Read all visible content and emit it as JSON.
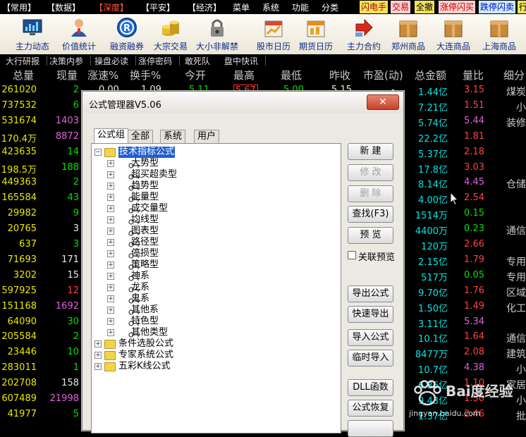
{
  "menubar": {
    "items": [
      "【常用】",
      "【数据】",
      "【深度】",
      "【平安】",
      "【经济】",
      "菜单",
      "系统",
      "功能",
      "分类"
    ],
    "active_index": 2,
    "quick_tabs": [
      {
        "label": "闪电手",
        "bg": "#f2e25a",
        "fg": "#b00000"
      },
      {
        "label": "交易",
        "bg": "#ffd0d0",
        "fg": "#c00000"
      },
      {
        "label": "全撤",
        "bg": "#f2e25a",
        "fg": "#000000"
      },
      {
        "label": "涨停闪买",
        "bg": "#ffd0d0",
        "fg": "#c00000"
      },
      {
        "label": "跌停闪卖",
        "bg": "#c8ecff",
        "fg": "#0000c0"
      },
      {
        "label": "行",
        "bg": "#f2e25a",
        "fg": "#000000"
      }
    ]
  },
  "toolbar": {
    "items": [
      {
        "label": "主力动态",
        "icon": "monitor-chart-icon"
      },
      {
        "label": "价值统计",
        "icon": "person-icon"
      },
      {
        "label": "融资融券",
        "icon": "registered-r-icon"
      },
      {
        "label": "大宗交易",
        "icon": "coin-stack-icon"
      },
      {
        "label": "大小非解禁",
        "icon": "padlock-icon"
      },
      {
        "label": "股市日历",
        "icon": "stock-calendar-icon"
      },
      {
        "label": "期货日历",
        "icon": "futures-calendar-icon"
      },
      {
        "label": "主力合约",
        "icon": "red-arrow-icon"
      },
      {
        "label": "郑州商品",
        "icon": "zhengzhou-box-icon"
      },
      {
        "label": "大连商品",
        "icon": "dalian-box-icon"
      },
      {
        "label": "上海商品",
        "icon": "shanghai-box-icon"
      }
    ]
  },
  "subtabs": [
    "大行研报",
    "决策内参",
    "操盘必读",
    "涨停密码",
    "敢死队",
    "盘中快讯"
  ],
  "table": {
    "headers": [
      "总量",
      "现量",
      "涨速%",
      "换手%",
      "今开",
      "最高",
      "最低",
      "昨收",
      "市盈(动)",
      "总金额",
      "量比",
      "细分"
    ],
    "top_row_partial": [
      "0.00",
      "1.09",
      "5.11",
      "5.67",
      "5.00",
      "5.15",
      "-"
    ],
    "rows": [
      {
        "vol": "261020",
        "now": "2",
        "now_color": "#00e000",
        "amt": "1.44亿",
        "ratio": "3.15",
        "ratio_color": "#ff4040",
        "ind": "煤炭"
      },
      {
        "vol": "737532",
        "now": "6",
        "now_color": "#00e000",
        "amt": "7.21亿",
        "ratio": "1.51",
        "ratio_color": "#ff4040",
        "ind": "小"
      },
      {
        "vol": "531674",
        "now": "1403",
        "now_color": "#e060e0",
        "amt": "5.74亿",
        "ratio": "5.44",
        "ratio_color": "#e060e0",
        "ind": "装修"
      },
      {
        "vol": "170.4万",
        "now": "8872",
        "now_color": "#e060e0",
        "amt": "22.2亿",
        "ratio": "1.81",
        "ratio_color": "#ff4040",
        "ind": ""
      },
      {
        "vol": "423635",
        "now": "14",
        "now_color": "#00e000",
        "amt": "5.37亿",
        "ratio": "2.18",
        "ratio_color": "#ff4040",
        "ind": ""
      },
      {
        "vol": "198.5万",
        "now": "188",
        "now_color": "#00e000",
        "amt": "17.8亿",
        "ratio": "3.03",
        "ratio_color": "#ff4040",
        "ind": ""
      },
      {
        "vol": "449363",
        "now": "2",
        "now_color": "#00e000",
        "amt": "8.14亿",
        "ratio": "4.45",
        "ratio_color": "#e060e0",
        "ind": "仓储"
      },
      {
        "vol": "165584",
        "now": "43",
        "now_color": "#00e000",
        "amt": "4.00亿",
        "ratio": "2.54",
        "ratio_color": "#ff4040",
        "ind": ""
      },
      {
        "vol": "29982",
        "now": "9",
        "now_color": "#00e000",
        "amt": "1514万",
        "ratio": "0.15",
        "ratio_color": "#00e000",
        "ind": ""
      },
      {
        "vol": "20765",
        "now": "3",
        "now_color": "#e8e8e8",
        "amt": "4400万",
        "ratio": "0.23",
        "ratio_color": "#00e000",
        "ind": "通信"
      },
      {
        "vol": "637",
        "now": "3",
        "now_color": "#00e000",
        "amt": "120万",
        "ratio": "2.66",
        "ratio_color": "#ff4040",
        "ind": ""
      },
      {
        "vol": "71693",
        "now": "171",
        "now_color": "#e8e8e8",
        "amt": "2.15亿",
        "ratio": "1.79",
        "ratio_color": "#ff4040",
        "ind": "专用"
      },
      {
        "vol": "3202",
        "now": "15",
        "now_color": "#e8e8e8",
        "amt": "517万",
        "ratio": "0.05",
        "ratio_color": "#00e000",
        "ind": "专用"
      },
      {
        "vol": "597925",
        "now": "12",
        "now_color": "#ff4040",
        "amt": "9.70亿",
        "ratio": "1.76",
        "ratio_color": "#ff4040",
        "ind": "区域"
      },
      {
        "vol": "151168",
        "now": "1692",
        "now_color": "#e060e0",
        "amt": "1.50亿",
        "ratio": "1.49",
        "ratio_color": "#ff4040",
        "ind": "化工"
      },
      {
        "vol": "64090",
        "now": "30",
        "now_color": "#00e000",
        "amt": "3.11亿",
        "ratio": "5.34",
        "ratio_color": "#e060e0",
        "ind": ""
      },
      {
        "vol": "205584",
        "now": "2",
        "now_color": "#00e000",
        "amt": "10.1亿",
        "ratio": "1.64",
        "ratio_color": "#ff4040",
        "ind": "通信"
      },
      {
        "vol": "23446",
        "now": "10",
        "now_color": "#00e000",
        "amt": "8477万",
        "ratio": "2.08",
        "ratio_color": "#ff4040",
        "ind": "建筑"
      },
      {
        "vol": "283011",
        "now": "1",
        "now_color": "#00e000",
        "amt": "10.7亿",
        "ratio": "4.38",
        "ratio_color": "#e060e0",
        "ind": "小"
      },
      {
        "vol": "202708",
        "now": "158",
        "now_color": "#e8e8e8",
        "amt": "6.36亿",
        "ratio": "1.10",
        "ratio_color": "#ff4040",
        "ind": "家居"
      },
      {
        "vol": "607489",
        "now": "21998",
        "now_color": "#e060e0",
        "amt": "9.43亿",
        "ratio": "1.50",
        "ratio_color": "#ff4040",
        "ind": "小"
      },
      {
        "vol": "41977",
        "now": "5",
        "now_color": "#00e000",
        "amt": "1.37亿",
        "ratio": "2.46",
        "ratio_color": "#ff4040",
        "ind": "批"
      }
    ]
  },
  "dialog": {
    "title": "公式管理器V5.06",
    "close_symbol": "✕",
    "tabs": [
      "公式组",
      "全部",
      "系统",
      "用户"
    ],
    "selected_tab": 0,
    "tree": {
      "root": "技术指标公式",
      "children": [
        "大势型",
        "超买超卖型",
        "趋势型",
        "能量型",
        "成交量型",
        "均线型",
        "图表型",
        "路径型",
        "停损型",
        "策略型",
        "神系",
        "龙系",
        "鬼系",
        "其他系",
        "特色型",
        "其他类型"
      ],
      "siblings": [
        "条件选股公式",
        "专家系统公式",
        "五彩K线公式"
      ]
    },
    "buttons": [
      {
        "label": "新 建",
        "enabled": true
      },
      {
        "label": "修 改",
        "enabled": false
      },
      {
        "label": "删 除",
        "enabled": false
      },
      {
        "label": "查找(F3)",
        "enabled": true
      },
      {
        "label": "预 览",
        "enabled": true
      },
      {
        "label": "导出公式",
        "enabled": true
      },
      {
        "label": "快速导出",
        "enabled": true
      },
      {
        "label": "导入公式",
        "enabled": true
      },
      {
        "label": "临时导入",
        "enabled": true
      },
      {
        "label": "DLL函数",
        "enabled": true
      },
      {
        "label": "公式恢复",
        "enabled": true
      },
      {
        "label": "",
        "enabled": true
      }
    ],
    "checkbox_label": "关联预览",
    "checkbox_checked": false
  },
  "watermark": {
    "brand": "Bai度经验",
    "url": "jingyan.baidu.com"
  }
}
